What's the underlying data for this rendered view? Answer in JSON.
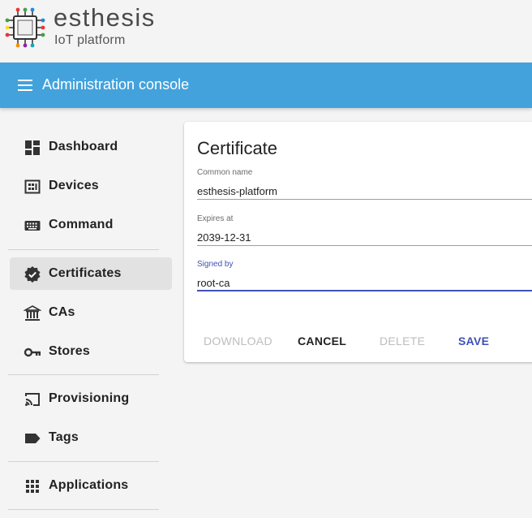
{
  "brand": {
    "name": "esthesis",
    "subtitle": "IoT platform",
    "logo_icon": "microchip-icon"
  },
  "toolbar": {
    "menu_icon": "menu-icon",
    "title": "Administration console",
    "color": "#43a2dc"
  },
  "sidebar": {
    "items": [
      {
        "label": "Dashboard",
        "icon": "dashboard-icon",
        "active": false
      },
      {
        "label": "Devices",
        "icon": "devices-icon",
        "active": false
      },
      {
        "label": "Command",
        "icon": "keyboard-icon",
        "active": false
      },
      {
        "label": "Certificates",
        "icon": "verified-badge-icon",
        "active": true
      },
      {
        "label": "CAs",
        "icon": "account-balance-icon",
        "active": false
      },
      {
        "label": "Stores",
        "icon": "key-icon",
        "active": false
      },
      {
        "label": "Provisioning",
        "icon": "cast-icon",
        "active": false
      },
      {
        "label": "Tags",
        "icon": "label-icon",
        "active": false
      },
      {
        "label": "Applications",
        "icon": "apps-grid-icon",
        "active": false
      }
    ]
  },
  "card": {
    "title": "Certificate",
    "fields": [
      {
        "label": "Common name",
        "value": "esthesis-platform",
        "focused": false
      },
      {
        "label": "Expires at",
        "value": "2039-12-31",
        "focused": false
      },
      {
        "label": "Signed by",
        "value": "root-ca",
        "focused": true
      }
    ],
    "actions": {
      "download": "DOWNLOAD",
      "cancel": "CANCEL",
      "delete": "DELETE",
      "save": "SAVE"
    }
  },
  "colors": {
    "accent": "#3f51b5",
    "disabled": "#bdbdbd",
    "toolbar": "#43a2dc"
  }
}
